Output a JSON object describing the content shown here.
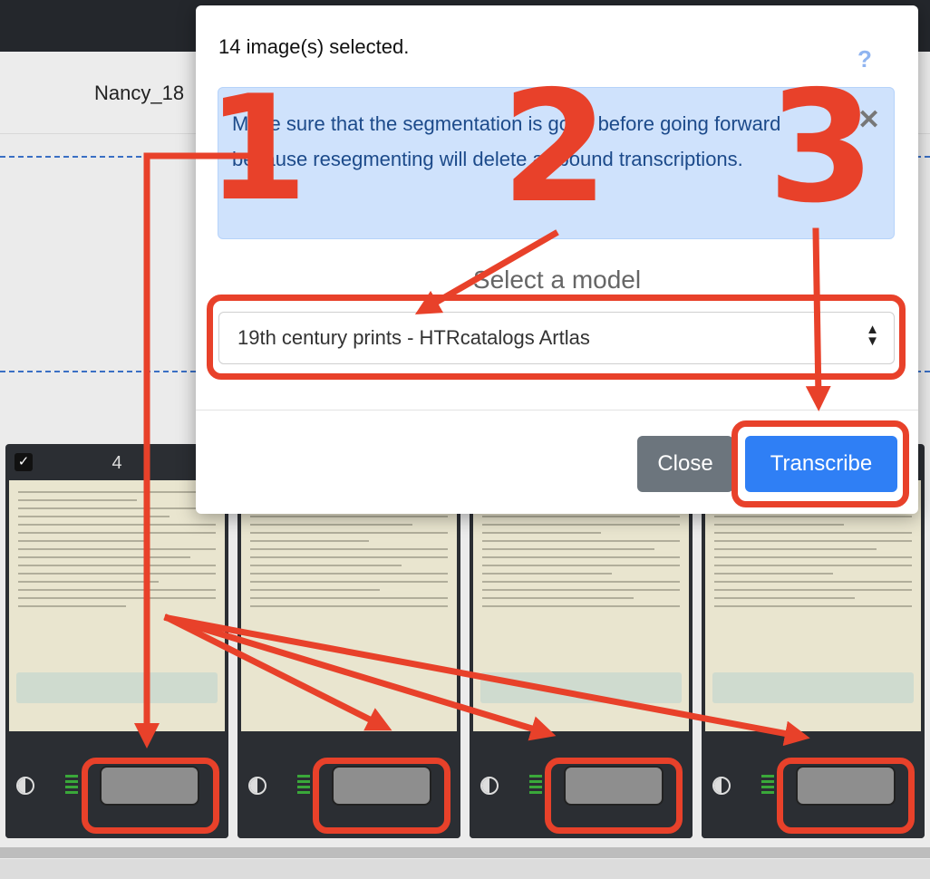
{
  "document": {
    "title": "Nancy_18"
  },
  "thumbnails": [
    {
      "number": "4",
      "checked": true,
      "check_glyph": "✓"
    },
    {
      "number": "",
      "checked": true
    },
    {
      "number": "",
      "checked": true
    },
    {
      "number": "",
      "checked": true
    }
  ],
  "modal": {
    "selection_count": "14 image(s) selected.",
    "help_icon": "?",
    "alert": {
      "text": "Make sure that the segmentation is good before going forward because resegmenting will delete all bound transcriptions.",
      "close_icon": "✕"
    },
    "model_label": "Select a model",
    "model_select": {
      "selected": "19th century prints - HTRcatalogs Artlas",
      "arrow_up": "▲",
      "arrow_down": "▼"
    },
    "buttons": {
      "close": "Close",
      "transcribe": "Transcribe"
    }
  },
  "annotations": {
    "step1": "1",
    "step2": "2",
    "step3": "3",
    "color": "#e8412a"
  }
}
